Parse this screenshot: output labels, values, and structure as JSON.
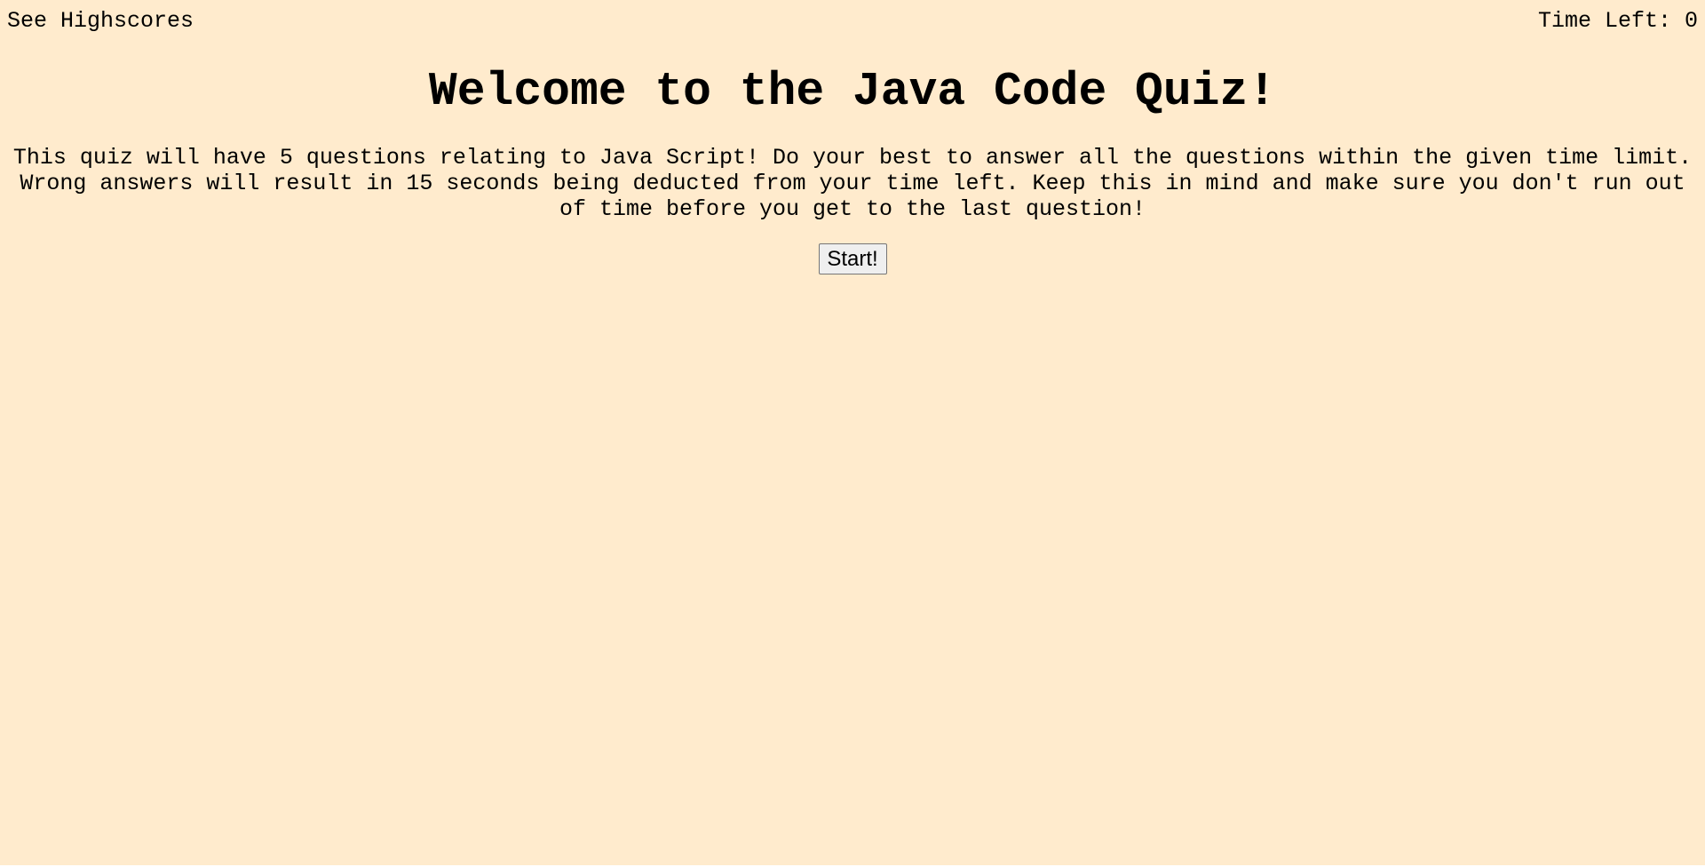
{
  "header": {
    "highscores_label": "See Highscores",
    "timer_label": "Time Left: ",
    "timer_value": "0"
  },
  "main": {
    "title": "Welcome to the Java Code Quiz!",
    "intro": "This quiz will have 5 questions relating to Java Script! Do your best to answer all the questions within the given time limit. Wrong answers will result in 15 seconds being deducted from your time left. Keep this in mind and make sure you don't run out of time before you get to the last question!",
    "start_label": "Start!"
  },
  "colors": {
    "background": "#ffebcd",
    "text": "#000000",
    "button_bg": "#efefef"
  }
}
